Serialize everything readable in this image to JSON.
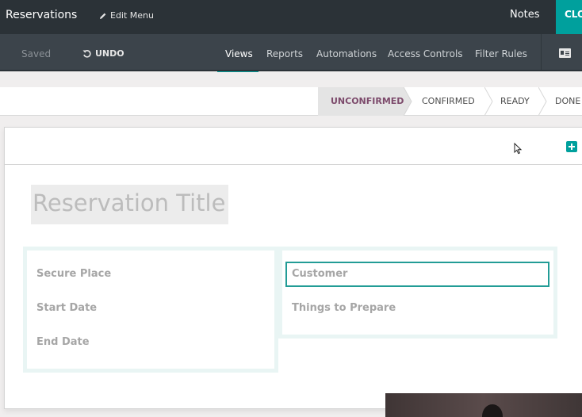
{
  "topbar": {
    "app_title": "Reservations",
    "edit_menu_label": "Edit Menu",
    "notes_label": "Notes",
    "close_label": "CLO"
  },
  "subbar": {
    "saved_label": "Saved",
    "undo_label": "UNDO",
    "menu": {
      "views": "Views",
      "reports": "Reports",
      "automations": "Automations",
      "access_controls": "Access Controls",
      "filter_rules": "Filter Rules"
    },
    "active_tab": "Views",
    "card_icon": "id-card-icon"
  },
  "statusbar": {
    "stages": [
      "UNCONFIRMED",
      "CONFIRMED",
      "READY",
      "DONE"
    ],
    "active_stage": "UNCONFIRMED"
  },
  "form": {
    "title_placeholder": "Reservation Title",
    "left_group": {
      "fields": [
        "Secure Place",
        "Start Date",
        "End Date"
      ]
    },
    "right_group": {
      "fields": [
        "Customer",
        "Things to Prepare"
      ]
    },
    "add_icon": "plus-square-icon"
  },
  "colors": {
    "topbar": "#2b3237",
    "subbar": "#3c444b",
    "accent": "#00a09d",
    "active_stage_text": "#7c4a6b"
  }
}
